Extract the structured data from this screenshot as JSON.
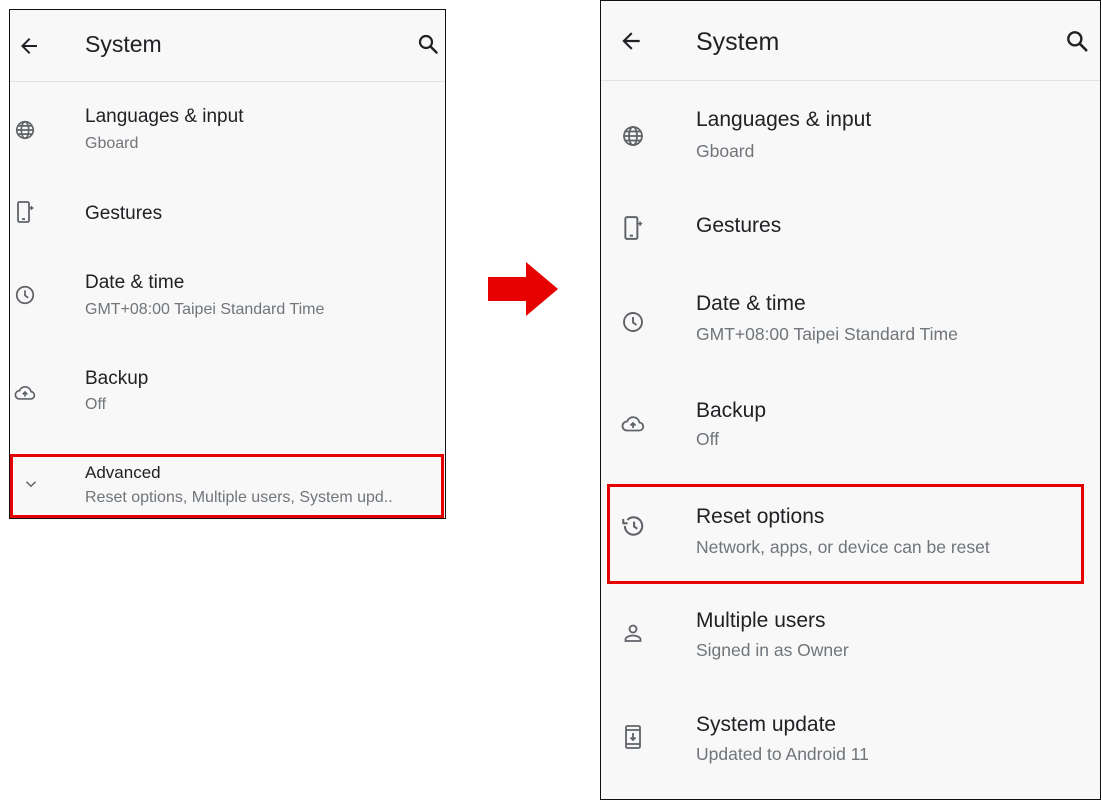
{
  "left_screen": {
    "appbar": {
      "title": "System"
    },
    "items": [
      {
        "label": "Languages & input",
        "sub": "Gboard",
        "icon": "globe-icon"
      },
      {
        "label": "Gestures",
        "sub": "",
        "icon": "gestures-phone-icon"
      },
      {
        "label": "Date & time",
        "sub": "GMT+08:00 Taipei Standard Time",
        "icon": "clock-icon"
      },
      {
        "label": "Backup",
        "sub": "Off",
        "icon": "cloud-upload-icon"
      },
      {
        "label": "Advanced",
        "sub": "Reset options, Multiple users, System upd..",
        "icon": "chevron-down-icon"
      }
    ]
  },
  "right_screen": {
    "appbar": {
      "title": "System"
    },
    "items": [
      {
        "label": "Languages & input",
        "sub": "Gboard",
        "icon": "globe-icon"
      },
      {
        "label": "Gestures",
        "sub": "",
        "icon": "gestures-phone-icon"
      },
      {
        "label": "Date & time",
        "sub": "GMT+08:00 Taipei Standard Time",
        "icon": "clock-icon"
      },
      {
        "label": "Backup",
        "sub": "Off",
        "icon": "cloud-upload-icon"
      },
      {
        "label": "Reset options",
        "sub": "Network, apps, or device can be reset",
        "icon": "history-reset-icon"
      },
      {
        "label": "Multiple users",
        "sub": "Signed in as Owner",
        "icon": "person-icon"
      },
      {
        "label": "System update",
        "sub": "Updated to Android 11",
        "icon": "system-update-icon"
      }
    ]
  },
  "colors": {
    "highlight": "#e60000",
    "arrow": "#e60000",
    "text_primary": "#202124",
    "text_secondary": "#70757a"
  }
}
